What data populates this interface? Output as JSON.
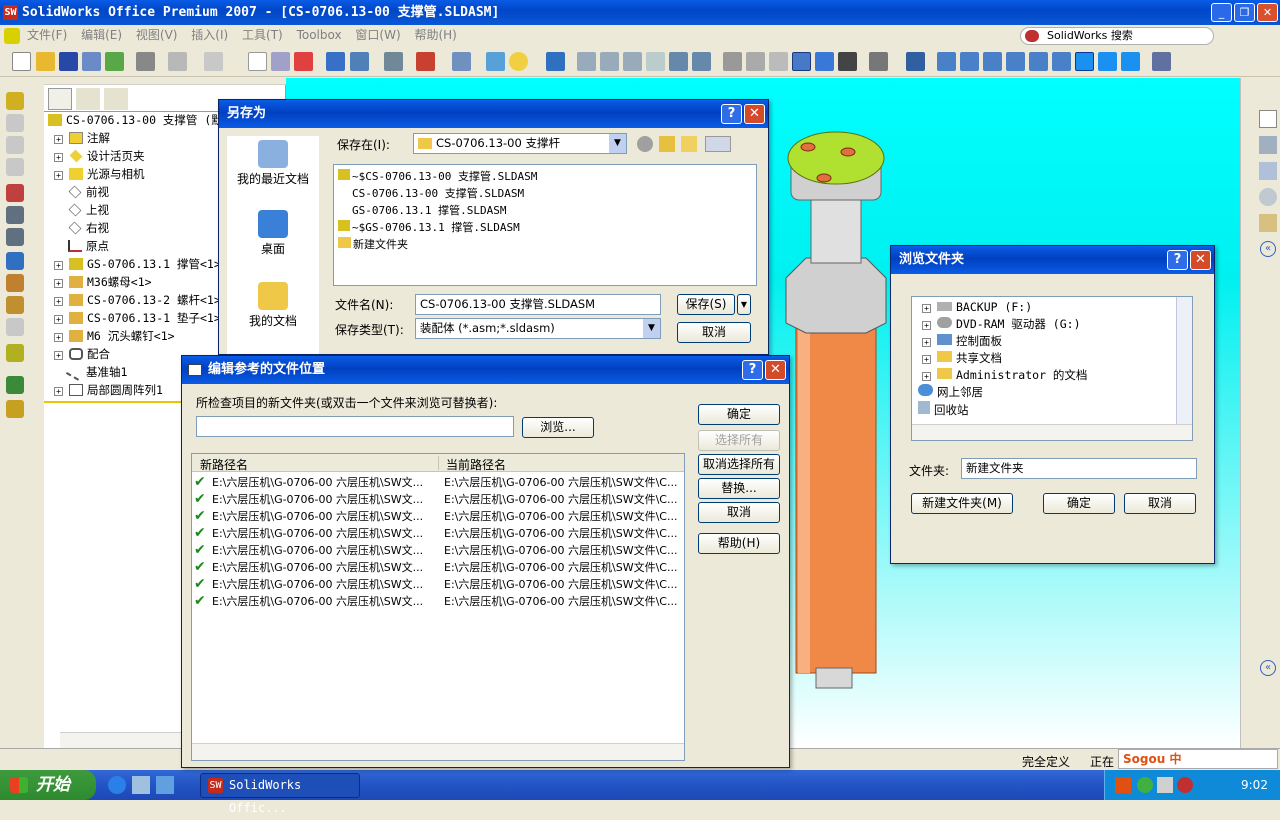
{
  "window": {
    "title": "SolidWorks Office Premium 2007 - [CS-0706.13-00  支撑管.SLDASM]"
  },
  "menu": {
    "items": [
      "文件(F)",
      "编辑(E)",
      "视图(V)",
      "插入(I)",
      "工具(T)",
      "Toolbox",
      "窗口(W)",
      "帮助(H)"
    ],
    "search_label": "SolidWorks 搜索"
  },
  "tree": {
    "root": "CS-0706.13-00  支撑管  (默",
    "items": [
      "注解",
      "设计活页夹",
      "光源与相机",
      "前视",
      "上视",
      "右视",
      "原点",
      "GS-0706.13.1  撑管<1>",
      "M36螺母<1>",
      "CS-0706.13-2  螺杆<1>",
      "CS-0706.13-1  垫子<1>",
      "M6 沉头螺钉<1>",
      "配合",
      "基准轴1",
      "局部圆周阵列1"
    ]
  },
  "saveas": {
    "title": "另存为",
    "save_in_label": "保存在(I):",
    "save_in_value": "CS-0706.13-00  支撑杆",
    "places": [
      "我的最近文档",
      "桌面",
      "我的文档"
    ],
    "files": [
      "~$CS-0706.13-00  支撑管.SLDASM",
      "CS-0706.13-00  支撑管.SLDASM",
      "GS-0706.13.1  撑管.SLDASM",
      "~$GS-0706.13.1  撑管.SLDASM",
      "新建文件夹"
    ],
    "filename_label": "文件名(N):",
    "filename_value": "CS-0706.13-00  支撑管.SLDASM",
    "filetype_label": "保存类型(T):",
    "filetype_value": "装配体 (*.asm;*.sldasm)",
    "save_button": "保存(S)",
    "cancel_button": "取消"
  },
  "editref": {
    "title": "编辑参考的文件位置",
    "prompt": "所检查项目的新文件夹(或双击一个文件来浏览可替换者):",
    "browse_button": "浏览...",
    "columns": [
      "新路径名",
      "当前路径名"
    ],
    "rows": [
      {
        "new": "E:\\六层压机\\G-0706-00 六层压机\\SW文...",
        "current": "E:\\六层压机\\G-0706-00 六层压机\\SW文件\\C..."
      },
      {
        "new": "E:\\六层压机\\G-0706-00 六层压机\\SW文...",
        "current": "E:\\六层压机\\G-0706-00 六层压机\\SW文件\\C..."
      },
      {
        "new": "E:\\六层压机\\G-0706-00 六层压机\\SW文...",
        "current": "E:\\六层压机\\G-0706-00 六层压机\\SW文件\\C..."
      },
      {
        "new": "E:\\六层压机\\G-0706-00 六层压机\\SW文...",
        "current": "E:\\六层压机\\G-0706-00 六层压机\\SW文件\\C..."
      },
      {
        "new": "E:\\六层压机\\G-0706-00 六层压机\\SW文...",
        "current": "E:\\六层压机\\G-0706-00 六层压机\\SW文件\\C..."
      },
      {
        "new": "E:\\六层压机\\G-0706-00 六层压机\\SW文...",
        "current": "E:\\六层压机\\G-0706-00 六层压机\\SW文件\\C..."
      },
      {
        "new": "E:\\六层压机\\G-0706-00 六层压机\\SW文...",
        "current": "E:\\六层压机\\G-0706-00 六层压机\\SW文件\\C..."
      },
      {
        "new": "E:\\六层压机\\G-0706-00 六层压机\\SW文...",
        "current": "E:\\六层压机\\G-0706-00 六层压机\\SW文件\\C..."
      }
    ],
    "buttons": {
      "ok": "确定",
      "select_all": "选择所有",
      "deselect_all": "取消选择所有",
      "replace": "替换...",
      "cancel": "取消",
      "help": "帮助(H)"
    }
  },
  "browse": {
    "title": "浏览文件夹",
    "items": [
      "BACKUP (F:)",
      "DVD-RAM 驱动器 (G:)",
      "控制面板",
      "共享文档",
      "Administrator 的文档",
      "网上邻居",
      "回收站"
    ],
    "folder_label": "文件夹:",
    "folder_value": "新建文件夹",
    "new_folder_button": "新建文件夹(M)",
    "ok_button": "确定",
    "cancel_button": "取消"
  },
  "status": {
    "defined": "完全定义",
    "editing": "正在"
  },
  "taskbar": {
    "start": "开始",
    "app": "SolidWorks Offic...",
    "clock": "9:02",
    "ime": "Sogou 中"
  }
}
